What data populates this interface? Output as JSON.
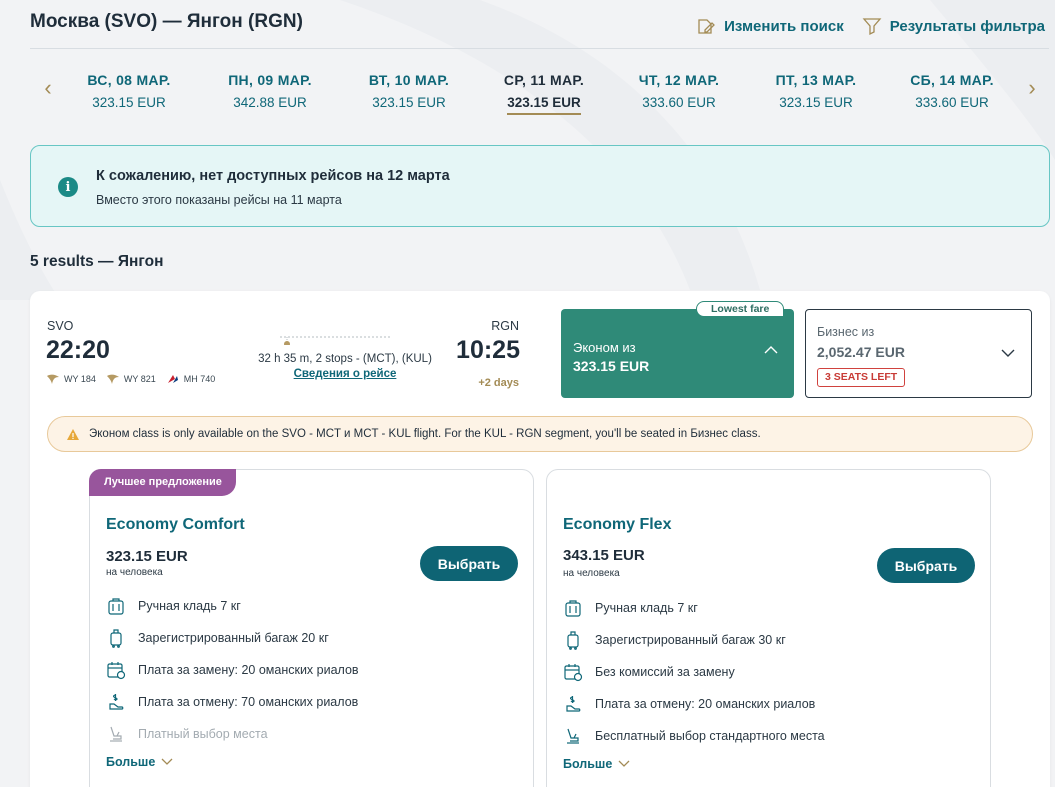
{
  "header": {
    "route_title": "Москва (SVO) — Янгон (RGN)",
    "modify_search": "Изменить поиск",
    "filter_results": "Результаты фильтра"
  },
  "date_strip": {
    "dates": [
      {
        "label": "ВС, 08 МАР.",
        "price": "323.15 EUR",
        "active": false
      },
      {
        "label": "ПН, 09 МАР.",
        "price": "342.88 EUR",
        "active": false
      },
      {
        "label": "ВТ, 10 МАР.",
        "price": "323.15 EUR",
        "active": false
      },
      {
        "label": "СР, 11 МАР.",
        "price": "323.15 EUR",
        "active": true
      },
      {
        "label": "ЧТ, 12 МАР.",
        "price": "333.60 EUR",
        "active": false
      },
      {
        "label": "ПТ, 13 МАР.",
        "price": "323.15 EUR",
        "active": false
      },
      {
        "label": "СБ, 14 МАР.",
        "price": "333.60 EUR",
        "active": false
      }
    ]
  },
  "info_banner": {
    "title": "К сожалению, нет доступных рейсов на 12 марта",
    "subtitle": "Вместо этого показаны рейсы на 11 марта"
  },
  "results_title": "5 results — Янгон",
  "flight": {
    "departure_code": "SVO",
    "departure_time": "22:20",
    "arrival_code": "RGN",
    "arrival_time": "10:25",
    "arrival_plus": "+2 days",
    "carriers": [
      "WY 184",
      "WY 821",
      "MH 740"
    ],
    "duration_info": "32 h 35 m, 2 stops - (MCT), (KUL)",
    "details_link": "Сведения о рейсе",
    "economy": {
      "label": "Эконом из",
      "price": "323.15 EUR",
      "tag": "Lowest fare"
    },
    "business": {
      "label": "Бизнес из",
      "price": "2,052.47 EUR",
      "seats_left": "3 SEATS LEFT"
    },
    "warning": "Эконом class is only available on the SVO - MCT и MCT - KUL flight. For the KUL - RGN segment, you'll be seated in Бизнес class."
  },
  "fares": [
    {
      "tag": "Лучшее предложение",
      "name": "Economy Comfort",
      "price": "323.15 EUR",
      "per_person": "на человека",
      "select": "Выбрать",
      "features": [
        "Ручная кладь 7 кг",
        "Зарегистрированный багаж 20 кг",
        "Плата за замену: 20 оманских риалов",
        "Плата за отмену: 70 оманских риалов",
        "Платный выбор места"
      ],
      "more": "Больше"
    },
    {
      "name": "Economy Flex",
      "price": "343.15 EUR",
      "per_person": "на человека",
      "select": "Выбрать",
      "features": [
        "Ручная кладь 7 кг",
        "Зарегистрированный багаж 30 кг",
        "Без комиссий за замену",
        "Плата за отмену: 20 оманских риалов",
        "Бесплатный выбор стандартного места"
      ],
      "more": "Больше"
    }
  ],
  "colors": {
    "accent_teal": "#0f6778",
    "economy_green": "#2f8a78",
    "gold": "#a38b55",
    "best_offer_purple": "#98559c",
    "seats_red": "#d0423e"
  },
  "icons": [
    "edit-icon",
    "filter-icon",
    "chevron-left-icon",
    "chevron-right-icon",
    "info-icon",
    "warning-icon",
    "cabin-bag-icon",
    "checked-bag-icon",
    "change-fee-icon",
    "cancel-fee-icon",
    "seat-icon",
    "chevron-down-icon",
    "chevron-up-icon"
  ]
}
